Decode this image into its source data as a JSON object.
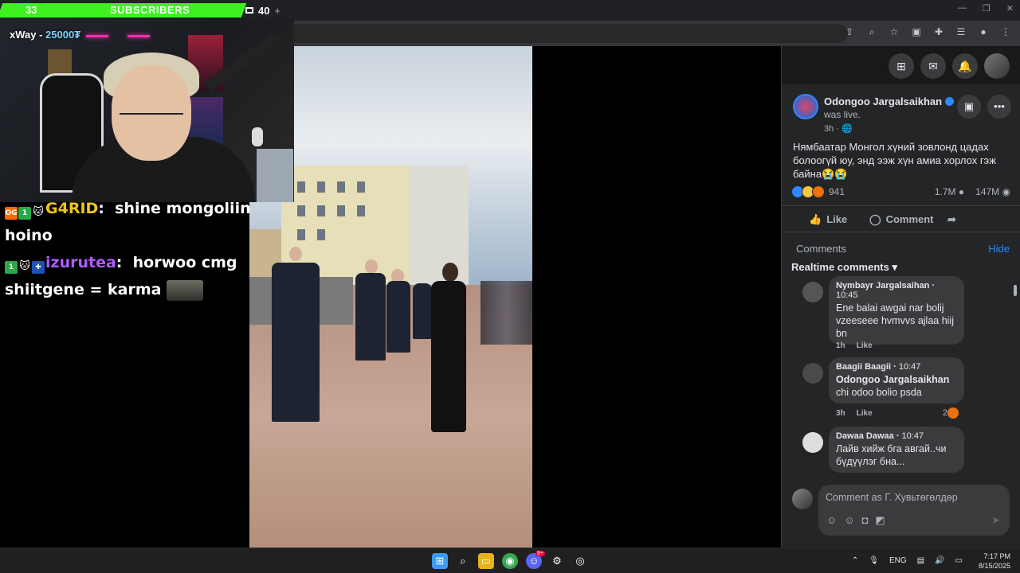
{
  "overlay": {
    "sub_count": "33",
    "sub_label": "SUBSCRIBERS",
    "sub_goal": "40",
    "cam_user": "xWay - ",
    "cam_amount": "25000₮"
  },
  "chat": [
    {
      "user": "G4RID",
      "sep": ":",
      "text": "shine mongoliin hoino"
    },
    {
      "user": "izurutea",
      "sep": ":",
      "text": "horwoo cmg shiitgene = karma"
    }
  ],
  "facebook": {
    "author": "Odongoo Jargalsaikhan",
    "status": "was live.",
    "time": "3h ·",
    "post_text": "Нямбаатар Монгол хүний зовлонд цадах болоогүй юу, энд ээж хүн амиа хорлох гэж байна😭😭",
    "reaction_count": "941",
    "comments_count": "1.7M",
    "views_count": "147M",
    "like_label": "Like",
    "comment_label": "Comment",
    "comments_header": "Comments",
    "hide_label": "Hide",
    "realtime_label": "Realtime comments",
    "comments": [
      {
        "name": "Nymbayr Jargalsaihan",
        "time": "10:45",
        "text": "Ene balai awgai nar bolij vzeeseee hvmvvs ajlaa hiij bn",
        "age": "1h",
        "like": "Like",
        "reactions": ""
      },
      {
        "name": "Baagii Baagii",
        "time": "10:47",
        "text": "Odongoo Jargalsaikhan chi odoo bolio psda",
        "mention": "Odongoo Jargalsaikhan",
        "age": "3h",
        "like": "Like",
        "reactions": "2"
      },
      {
        "name": "Dawaa Dawaa",
        "time": "10:47",
        "text": "Лайв хийж бга авгай..чи бүдүүлэг бна...",
        "age": "",
        "like": "",
        "reactions": ""
      }
    ],
    "compose_placeholder": "Comment as Г. Хувьтөгөлдөр"
  },
  "taskbar": {
    "lang": "ENG",
    "time": "7:17 PM",
    "date": "8/15/2025",
    "discord_badge": "9+"
  }
}
